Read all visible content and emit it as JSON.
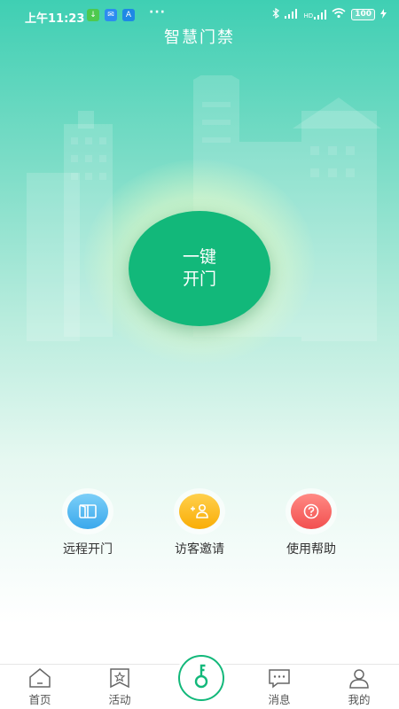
{
  "status_bar": {
    "time": "上午11:23",
    "dots": "···",
    "battery": "100",
    "signal_label": "HD"
  },
  "header": {
    "title": "智慧门禁"
  },
  "main": {
    "open_button": {
      "line1": "一键",
      "line2": "开门"
    }
  },
  "quick_actions": [
    {
      "label": "远程开门",
      "icon": "door-icon",
      "color": "#47b3ef"
    },
    {
      "label": "访客邀请",
      "icon": "visitor-icon",
      "color": "#fbb714"
    },
    {
      "label": "使用帮助",
      "icon": "help-icon",
      "color": "#f65a5a"
    }
  ],
  "tabbar": {
    "items": [
      {
        "label": "首页",
        "icon": "home-icon"
      },
      {
        "label": "活动",
        "icon": "activity-icon"
      },
      {
        "label": "",
        "icon": "key-icon"
      },
      {
        "label": "消息",
        "icon": "message-icon"
      },
      {
        "label": "我的",
        "icon": "profile-icon"
      }
    ]
  },
  "colors": {
    "primary": "#12b87a",
    "header_top": "#3fcfb3"
  }
}
